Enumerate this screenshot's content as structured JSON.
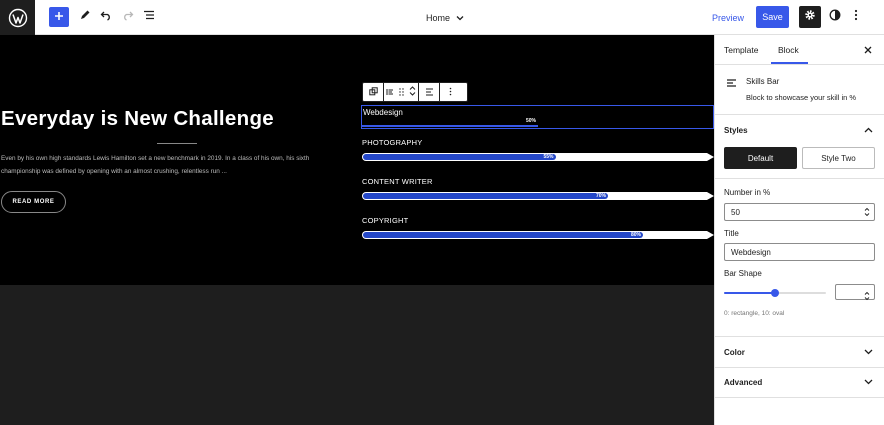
{
  "topbar": {
    "document_title": "Home",
    "preview_label": "Preview",
    "save_label": "Save"
  },
  "icons": {
    "logo": "wordpress-icon",
    "add": "plus-icon",
    "edit": "pencil-icon",
    "undo": "undo-icon",
    "redo": "redo-icon",
    "list_view": "list-view-icon",
    "settings": "gear-icon",
    "styles": "half-circle-icon",
    "options": "vertical-ellipsis-icon"
  },
  "hero": {
    "title": "Everyday is New Challenge",
    "description": "Even by his own high standards Lewis Hamilton set a new benchmark in 2019. In a class of his own, his sixth championship was defined by opening with an almost crushing, relentless run ...",
    "button_label": "READ MORE"
  },
  "skills": {
    "selected": {
      "title": "Webdesign",
      "percent_label": "50%",
      "value": 50
    },
    "items": [
      {
        "label": "PHOTOGRAPHY",
        "percent_label": "55%",
        "value": 55
      },
      {
        "label": "CONTENT WRITER",
        "percent_label": "70%",
        "value": 70
      },
      {
        "label": "COPYRIGHT",
        "percent_label": "80%",
        "value": 80
      }
    ]
  },
  "sidebar": {
    "tabs": [
      "Template",
      "Block"
    ],
    "active_tab": "Block",
    "block": {
      "name": "Skills Bar",
      "description": "Block to showcase your skill in %"
    },
    "styles_panel": {
      "title": "Styles",
      "options": [
        "Default",
        "Style Two"
      ],
      "selected": "Default"
    },
    "number_label": "Number in %",
    "number_value": "50",
    "title_label": "Title",
    "title_value": "Webdesign",
    "bar_shape_label": "Bar Shape",
    "bar_shape_value": 0.5,
    "bar_shape_help": "0: rectangle, 10: oval",
    "color_panel": "Color",
    "advanced_panel": "Advanced"
  },
  "colors": {
    "accent": "#3858e9",
    "bar_fill": "#2447c8",
    "dark": "#1e1e1e"
  }
}
